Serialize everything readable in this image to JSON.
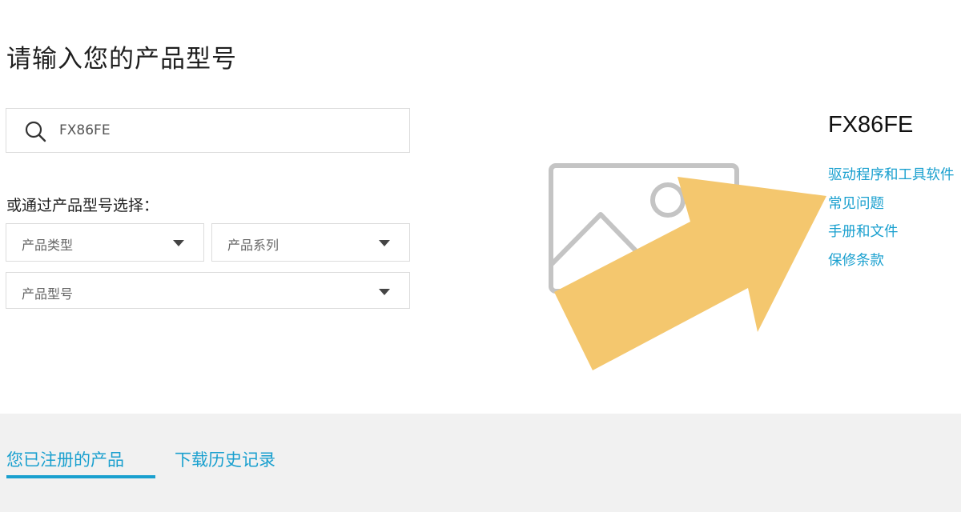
{
  "page_title": "请输入您的产品型号",
  "search": {
    "value": "FX86FE",
    "placeholder": "",
    "icon": "search-icon"
  },
  "select_label": "或通过产品型号选择：",
  "dropdowns": {
    "product_type": "产品类型",
    "product_series": "产品系列",
    "product_model": "产品型号"
  },
  "product": {
    "model_name": "FX86FE",
    "links": [
      "驱动程序和工具软件",
      "常见问题",
      "手册和文件",
      "保修条款"
    ]
  },
  "tabs": {
    "registered_products": "您已注册的产品",
    "download_history": "下载历史记录",
    "active": "registered_products"
  },
  "colors": {
    "accent": "#1aa0cf",
    "arrow": "#f4c76e",
    "placeholder_gray": "#c4c4c4",
    "band_background": "#f1f1f1"
  }
}
